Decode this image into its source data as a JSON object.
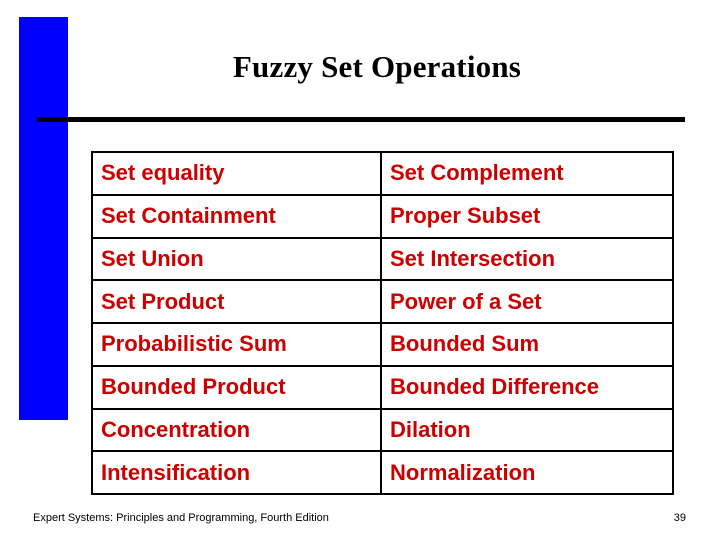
{
  "slide": {
    "title": "Fuzzy Set Operations",
    "accent_color": "#0000ff",
    "text_color": "#cc0000",
    "rule_color": "#000000",
    "background": "#ffffff"
  },
  "operations_table": {
    "rows": [
      {
        "left": "Set equality",
        "right": "Set Complement"
      },
      {
        "left": "Set Containment",
        "right": "Proper Subset"
      },
      {
        "left": "Set Union",
        "right": "Set Intersection"
      },
      {
        "left": "Set Product",
        "right": "Power of a Set"
      },
      {
        "left": "Probabilistic Sum",
        "right": "Bounded Sum"
      },
      {
        "left": "Bounded Product",
        "right": "Bounded Difference"
      },
      {
        "left": "Concentration",
        "right": "Dilation"
      },
      {
        "left": "Intensification",
        "right": "Normalization"
      }
    ]
  },
  "footer": {
    "source": "Expert Systems: Principles and Programming, Fourth Edition",
    "page_number": "39"
  }
}
